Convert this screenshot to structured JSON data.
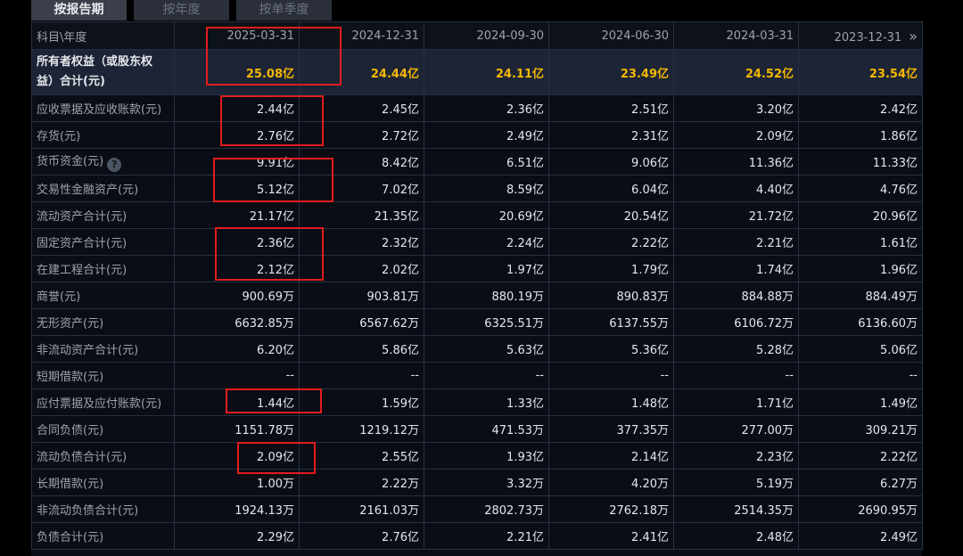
{
  "tabs": [
    "按报告期",
    "按年度",
    "按单季度"
  ],
  "header": {
    "label": "科目\\年度",
    "dates": [
      "2025-03-31",
      "2024-12-31",
      "2024-09-30",
      "2024-06-30",
      "2024-03-31",
      "2023-12-31"
    ]
  },
  "icons": {
    "help": "question-circle-icon",
    "next": "chevron-double-right-icon"
  },
  "rows": [
    {
      "label": "所有者权益（或股东权益）合计(元)",
      "values": [
        "25.08亿",
        "24.44亿",
        "24.11亿",
        "23.49亿",
        "24.52亿",
        "23.54亿"
      ]
    },
    {
      "label": "应收票据及应收账款(元)",
      "values": [
        "2.44亿",
        "2.45亿",
        "2.36亿",
        "2.51亿",
        "3.20亿",
        "2.42亿"
      ]
    },
    {
      "label": "存货(元)",
      "values": [
        "2.76亿",
        "2.72亿",
        "2.49亿",
        "2.31亿",
        "2.09亿",
        "1.86亿"
      ]
    },
    {
      "label": "货币资金(元)",
      "values": [
        "9.91亿",
        "8.42亿",
        "6.51亿",
        "9.06亿",
        "11.36亿",
        "11.33亿"
      ]
    },
    {
      "label": "交易性金融资产(元)",
      "values": [
        "5.12亿",
        "7.02亿",
        "8.59亿",
        "6.04亿",
        "4.40亿",
        "4.76亿"
      ]
    },
    {
      "label": "流动资产合计(元)",
      "values": [
        "21.17亿",
        "21.35亿",
        "20.69亿",
        "20.54亿",
        "21.72亿",
        "20.96亿"
      ]
    },
    {
      "label": "固定资产合计(元)",
      "values": [
        "2.36亿",
        "2.32亿",
        "2.24亿",
        "2.22亿",
        "2.21亿",
        "1.61亿"
      ]
    },
    {
      "label": "在建工程合计(元)",
      "values": [
        "2.12亿",
        "2.02亿",
        "1.97亿",
        "1.79亿",
        "1.74亿",
        "1.96亿"
      ]
    },
    {
      "label": "商誉(元)",
      "values": [
        "900.69万",
        "903.81万",
        "880.19万",
        "890.83万",
        "884.88万",
        "884.49万"
      ]
    },
    {
      "label": "无形资产(元)",
      "values": [
        "6632.85万",
        "6567.62万",
        "6325.51万",
        "6137.55万",
        "6106.72万",
        "6136.60万"
      ]
    },
    {
      "label": "非流动资产合计(元)",
      "values": [
        "6.20亿",
        "5.86亿",
        "5.63亿",
        "5.36亿",
        "5.28亿",
        "5.06亿"
      ]
    },
    {
      "label": "短期借款(元)",
      "values": [
        "--",
        "--",
        "--",
        "--",
        "--",
        "--"
      ]
    },
    {
      "label": "应付票据及应付账款(元)",
      "values": [
        "1.44亿",
        "1.59亿",
        "1.33亿",
        "1.48亿",
        "1.71亿",
        "1.49亿"
      ]
    },
    {
      "label": "合同负债(元)",
      "values": [
        "1151.78万",
        "1219.12万",
        "471.53万",
        "377.35万",
        "277.00万",
        "309.21万"
      ]
    },
    {
      "label": "流动负债合计(元)",
      "values": [
        "2.09亿",
        "2.55亿",
        "1.93亿",
        "2.14亿",
        "2.23亿",
        "2.22亿"
      ]
    },
    {
      "label": "长期借款(元)",
      "values": [
        "1.00万",
        "2.22万",
        "3.32万",
        "4.20万",
        "5.19万",
        "6.27万"
      ]
    },
    {
      "label": "非流动负债合计(元)",
      "values": [
        "1924.13万",
        "2161.03万",
        "2802.73万",
        "2762.18万",
        "2514.35万",
        "2690.95万"
      ]
    },
    {
      "label": "负债合计(元)",
      "values": [
        "2.29亿",
        "2.76亿",
        "2.21亿",
        "2.41亿",
        "2.48亿",
        "2.49亿"
      ]
    }
  ]
}
